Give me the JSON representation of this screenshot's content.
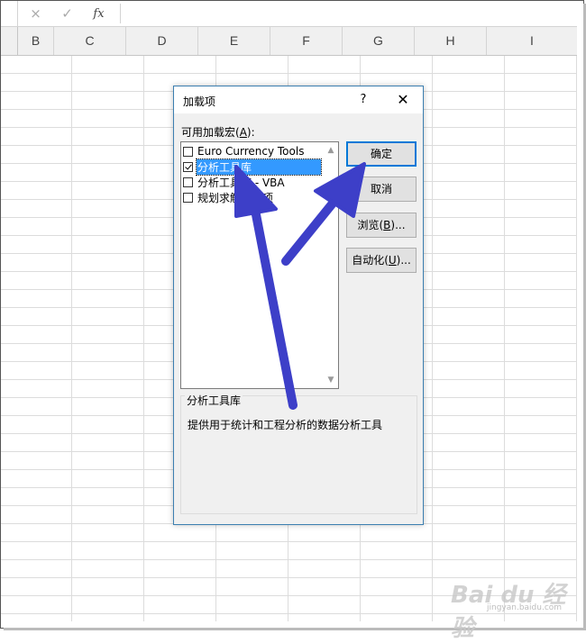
{
  "formula_bar": {
    "cancel_icon": "×",
    "confirm_icon": "✓",
    "fx_label": "fx",
    "value": ""
  },
  "columns": [
    "B",
    "C",
    "D",
    "E",
    "F",
    "G",
    "H",
    "I"
  ],
  "dialog": {
    "title": "加载项",
    "help_label": "?",
    "close_label": "✕",
    "list_label_pre": "可用加载宏(",
    "list_label_key": "A",
    "list_label_post": "):",
    "items": [
      {
        "label": "Euro Currency Tools",
        "checked": false,
        "selected": false
      },
      {
        "label": "分析工具库",
        "checked": true,
        "selected": true
      },
      {
        "label": "分析工具库 - VBA",
        "checked": false,
        "selected": false
      },
      {
        "label": "规划求解加载项",
        "checked": false,
        "selected": false
      }
    ],
    "buttons": {
      "ok": "确定",
      "cancel": "取消",
      "browse_pre": "浏览(",
      "browse_key": "B",
      "browse_post": ")...",
      "automation_pre": "自动化(",
      "automation_key": "U",
      "automation_post": ")..."
    },
    "description": {
      "title": "分析工具库",
      "text": "提供用于统计和工程分析的数据分析工具"
    }
  },
  "watermark": {
    "main": "Bai du 经验",
    "sub": "jingyan.baidu.com"
  },
  "colors": {
    "accent": "#0078d7",
    "selection": "#3399ff",
    "arrow": "#3d3fc8"
  }
}
